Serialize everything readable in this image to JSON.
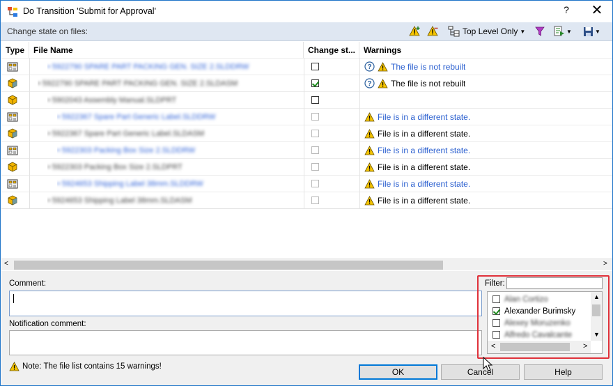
{
  "window": {
    "title": "Do Transition 'Submit for Approval'",
    "help_glyph": "?",
    "close_glyph": "✕"
  },
  "toolbar": {
    "label": "Change state on files:",
    "level_label": "Top Level Only",
    "icons": [
      "warning-add-icon",
      "warning-remove-icon",
      "tree-view-icon",
      "filter-icon",
      "export-icon",
      "save-icon"
    ]
  },
  "grid": {
    "columns": [
      "Type",
      "File Name",
      "Change st...",
      "Warnings"
    ],
    "rows": [
      {
        "type": "drawing",
        "name": "5922790 SPARE PART PACKING GEN. SIZE 2.SLDDRW",
        "indent": 1,
        "link": true,
        "check": "off",
        "check_enabled": true,
        "help": true,
        "warning": "The file is not rebuilt",
        "warning_blue": true
      },
      {
        "type": "assembly",
        "name": "5922790 SPARE PART PACKING GEN. SIZE 2.SLDASM",
        "indent": 0,
        "link": false,
        "check": "on",
        "check_enabled": true,
        "help": true,
        "warning": "The file is not rebuilt",
        "warning_blue": false
      },
      {
        "type": "part",
        "name": "5902043 Assembly Manual.SLDPRT",
        "indent": 1,
        "link": false,
        "check": "off",
        "check_enabled": true,
        "help": false,
        "warning": "",
        "warning_blue": false
      },
      {
        "type": "drawing",
        "name": "5922367 Spare Part Generic Label.SLDDRW",
        "indent": 2,
        "link": true,
        "check": "off",
        "check_enabled": false,
        "help": false,
        "warning": "File is in a different state.",
        "warning_blue": true
      },
      {
        "type": "assembly",
        "name": "5922367 Spare Part Generic Label.SLDASM",
        "indent": 1,
        "link": false,
        "check": "off",
        "check_enabled": false,
        "help": false,
        "warning": "File is in a different state.",
        "warning_blue": false
      },
      {
        "type": "drawing",
        "name": "5922303 Packing Box Size 2.SLDDRW",
        "indent": 2,
        "link": true,
        "check": "off",
        "check_enabled": false,
        "help": false,
        "warning": "File is in a different state.",
        "warning_blue": true
      },
      {
        "type": "part",
        "name": "5922303 Packing Box Size 2.SLDPRT",
        "indent": 1,
        "link": false,
        "check": "off",
        "check_enabled": false,
        "help": false,
        "warning": "File is in a different state.",
        "warning_blue": false
      },
      {
        "type": "drawing",
        "name": "5924653 Shipping Label 38mm.SLDDRW",
        "indent": 2,
        "link": true,
        "check": "off",
        "check_enabled": false,
        "help": false,
        "warning": "File is in a different state.",
        "warning_blue": true
      },
      {
        "type": "assembly",
        "name": "5924653 Shipping Label 38mm.SLDASM",
        "indent": 1,
        "link": false,
        "check": "off",
        "check_enabled": false,
        "help": false,
        "warning": "File is in a different state.",
        "warning_blue": false
      }
    ]
  },
  "bottom": {
    "comment_label": "Comment:",
    "comment_value": "",
    "notification_label": "Notification comment:",
    "notification_value": "",
    "note": "Note: The file list contains 15 warnings!",
    "filter_label": "Filter:",
    "filter_value": "",
    "users": [
      {
        "name": "Alan Cortizo",
        "checked": false,
        "blurred": true
      },
      {
        "name": "Alexander Burimsky",
        "checked": true,
        "blurred": false
      },
      {
        "name": "Alexey Moruzenko",
        "checked": false,
        "blurred": true
      },
      {
        "name": "Alfredo Cavalcante",
        "checked": false,
        "blurred": true
      }
    ],
    "buttons": {
      "ok": "OK",
      "cancel": "Cancel",
      "help": "Help"
    }
  },
  "colors": {
    "accent": "#1e74c8",
    "toolbar_bg": "#dfe7f2",
    "warning_yellow": "#f5c400",
    "link_blue": "#2a5fcf",
    "highlight_red": "#e0313a"
  }
}
